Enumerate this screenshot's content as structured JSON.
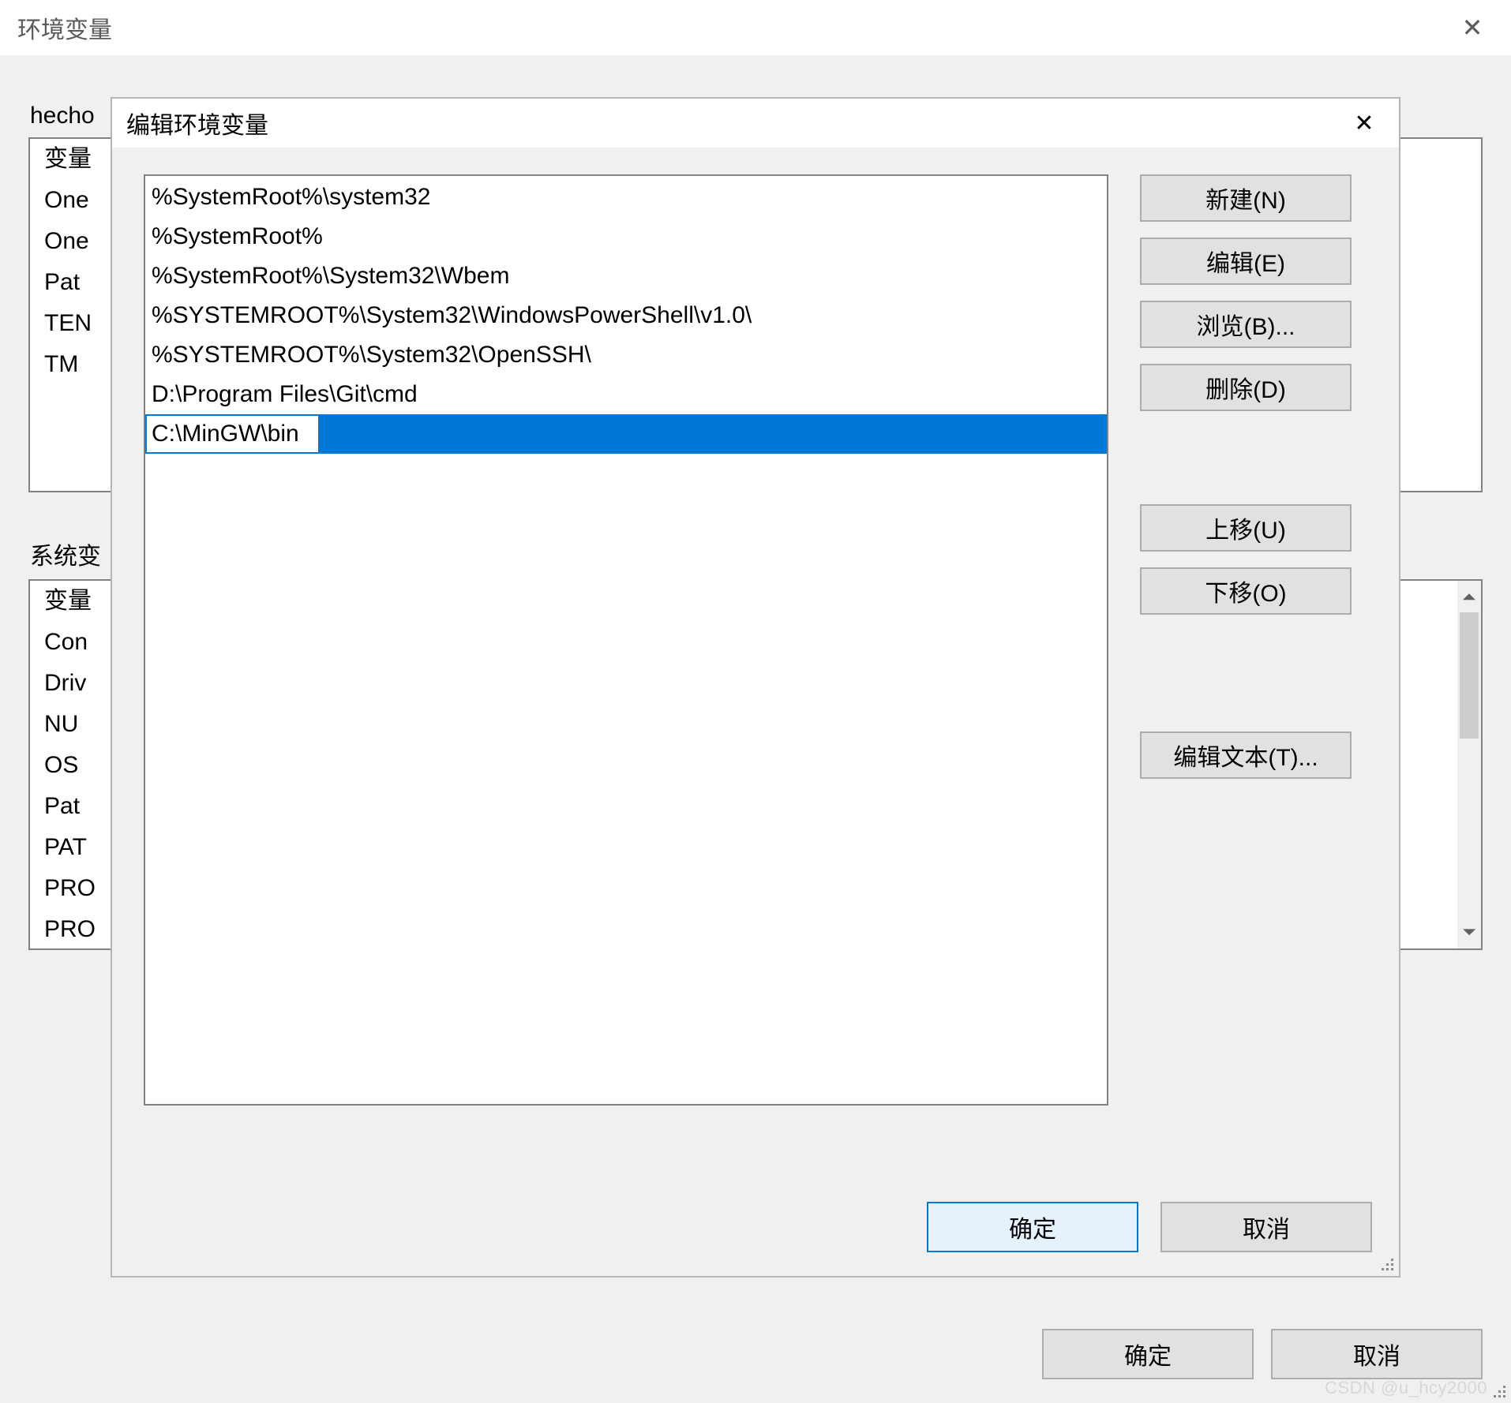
{
  "parent": {
    "title": "环境变量",
    "close_glyph": "✕",
    "user_section_label_truncated": "hecho",
    "sys_section_label_truncated": "系统变",
    "user_vars_truncated": [
      "变量",
      "One",
      "One",
      "Pat",
      "TEN",
      "TM"
    ],
    "sys_vars_truncated": [
      "变量",
      "Con",
      "Driv",
      "NU",
      "OS",
      "Pat",
      "PAT",
      "PRO",
      "PRO"
    ],
    "btn_ok": "确定",
    "btn_cancel": "取消"
  },
  "edit": {
    "title": "编辑环境变量",
    "close_glyph": "✕",
    "path_items": [
      "%SystemRoot%\\system32",
      "%SystemRoot%",
      "%SystemRoot%\\System32\\Wbem",
      "%SYSTEMROOT%\\System32\\WindowsPowerShell\\v1.0\\",
      "%SYSTEMROOT%\\System32\\OpenSSH\\",
      "D:\\Program Files\\Git\\cmd"
    ],
    "path_item_editing": "C:\\MinGW\\bin",
    "buttons": {
      "new": "新建(N)",
      "edit": "编辑(E)",
      "browse": "浏览(B)...",
      "delete": "删除(D)",
      "move_up": "上移(U)",
      "move_down": "下移(O)",
      "edit_text": "编辑文本(T)...",
      "ok": "确定",
      "cancel": "取消"
    }
  },
  "watermark": "CSDN @u_hcy2000"
}
